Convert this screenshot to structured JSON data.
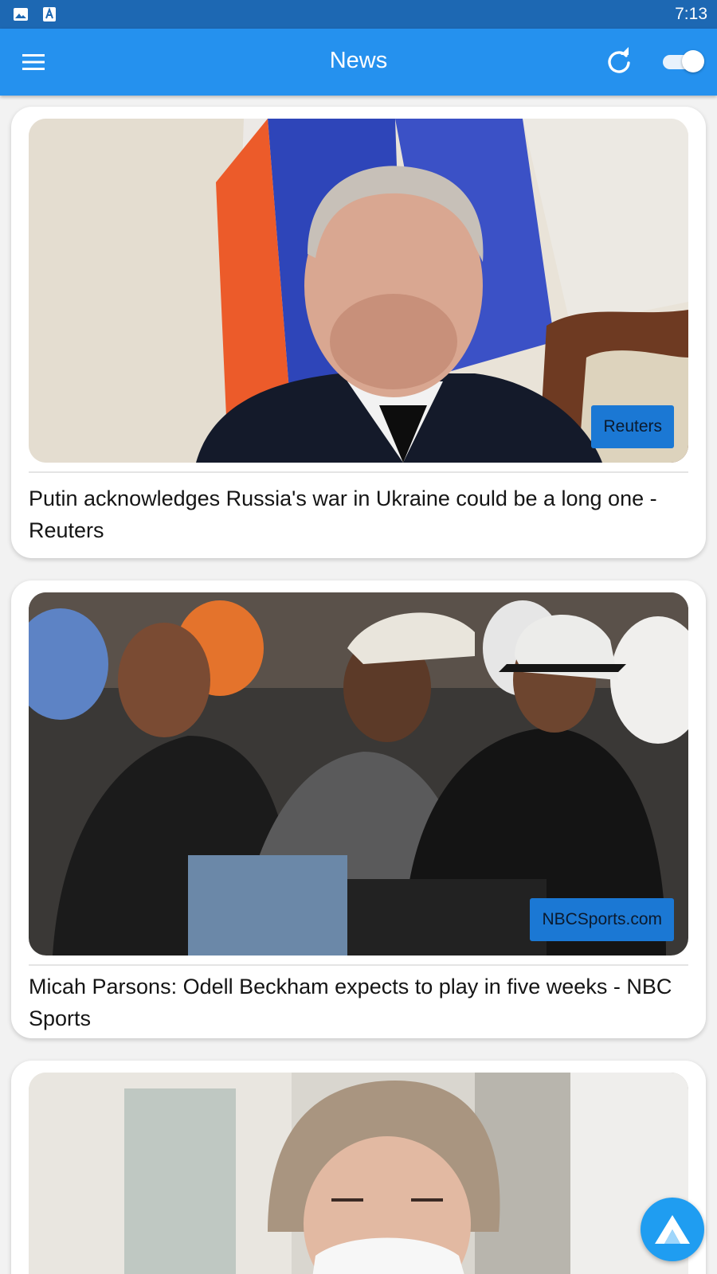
{
  "status_bar": {
    "time": "7:13",
    "icons": [
      "image-icon",
      "font-a-icon"
    ]
  },
  "app_bar": {
    "title": "News",
    "icons": [
      "menu-icon",
      "refresh-icon"
    ],
    "dark_mode_toggle_on": true
  },
  "articles": [
    {
      "source": "Reuters",
      "headline": "Putin acknowledges Russia's war in Ukraine could be a long one - Reuters"
    },
    {
      "source": "NBCSports.com",
      "headline": "Micah Parsons: Odell Beckham expects to play in five weeks - NBC Sports"
    },
    {
      "source": "",
      "headline": ""
    }
  ],
  "fab": {
    "icon": "app-logo-icon"
  },
  "colors": {
    "status_bar": "#1d68b3",
    "app_bar": "#2591ee",
    "badge": "#1b78d4",
    "fab": "#1f9df1",
    "background": "#f2f2f2"
  }
}
